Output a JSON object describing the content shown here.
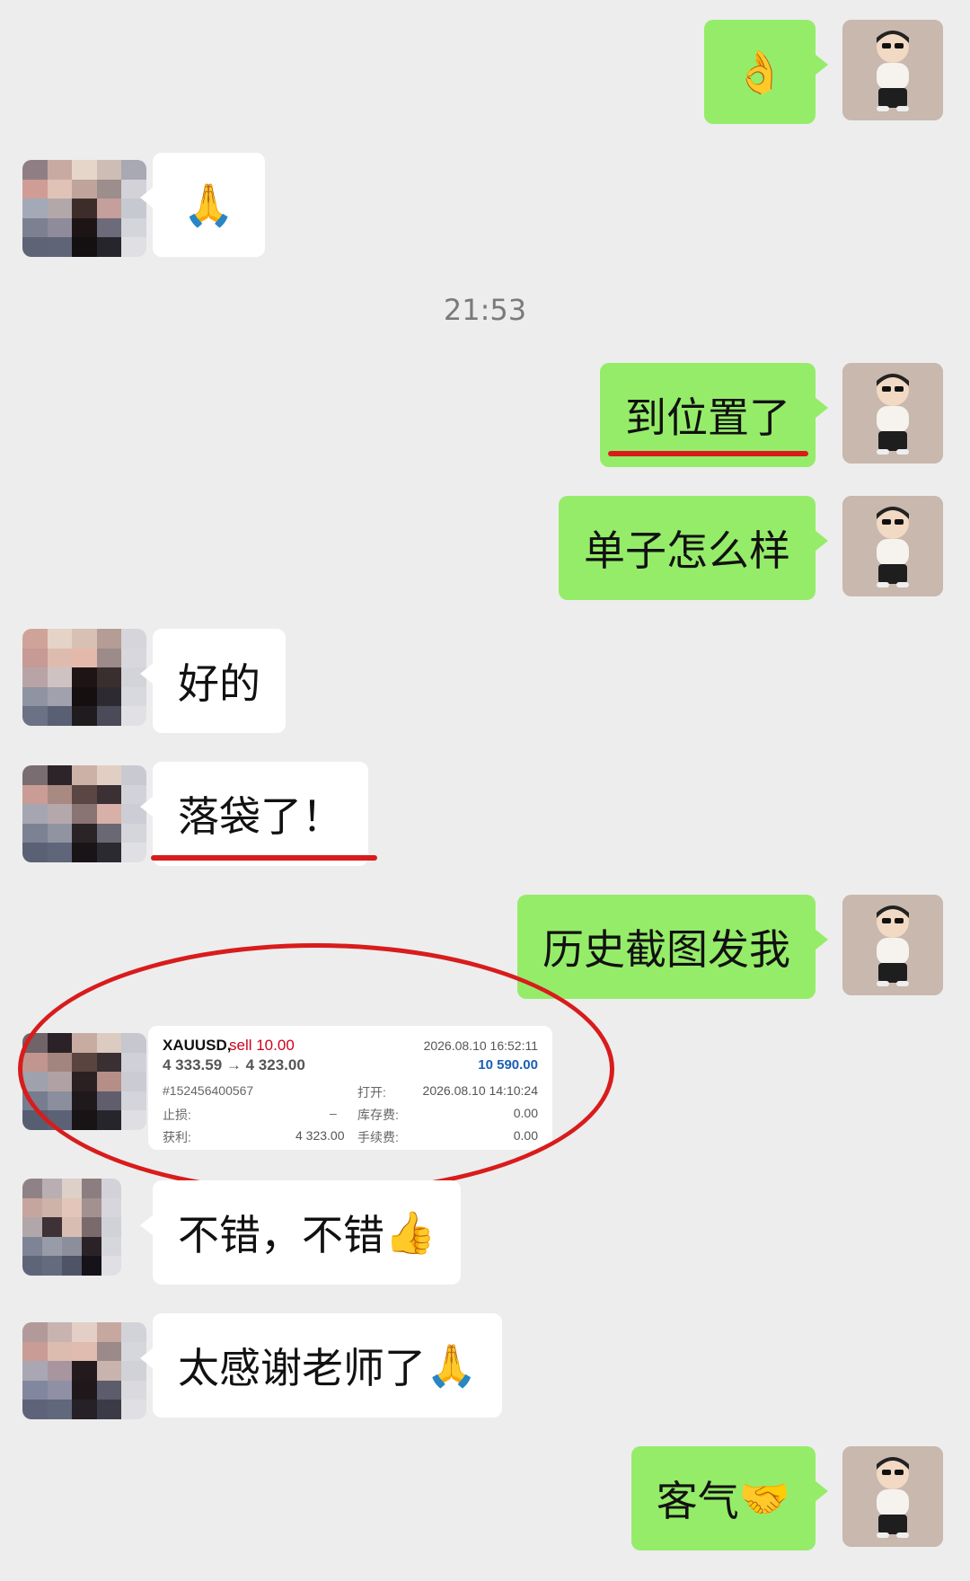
{
  "timestamp": "21:53",
  "messages": {
    "m1": {
      "emoji": "👌"
    },
    "m2": {
      "emoji": "🙏"
    },
    "m3": {
      "text": "到位置了"
    },
    "m4": {
      "text": "单子怎么样"
    },
    "m5": {
      "text": "好的"
    },
    "m6": {
      "text": "落袋了！"
    },
    "m7": {
      "text": "历史截图发我"
    },
    "m9": {
      "text": "不错，不错",
      "emoji": "👍"
    },
    "m10": {
      "text": "太感谢老师了",
      "emoji": "🙏"
    },
    "m11": {
      "text": "客气",
      "emoji": "🤝"
    }
  },
  "trade_card": {
    "symbol": "XAUUSD,",
    "side": "sell 10.00",
    "prices": "4 333.59 → 4 323.00",
    "close_time": "2026.08.10 16:52:11",
    "profit": "10 590.00",
    "order_id": "#152456400567",
    "open_label": "打开:",
    "open_time": "2026.08.10 14:10:24",
    "sl_label": "止损:",
    "sl_value": "–",
    "swap_label": "库存费:",
    "swap_value": "0.00",
    "tp_label": "获利:",
    "tp_value": "4 323.00",
    "fee_label": "手续费:",
    "fee_value": "0.00"
  },
  "colors": {
    "my_bubble": "#95ec69",
    "other_bubble": "#ffffff",
    "background": "#ededed",
    "annotation": "#d81c1c",
    "sell": "#d0021b",
    "profit": "#1a5fb4"
  }
}
